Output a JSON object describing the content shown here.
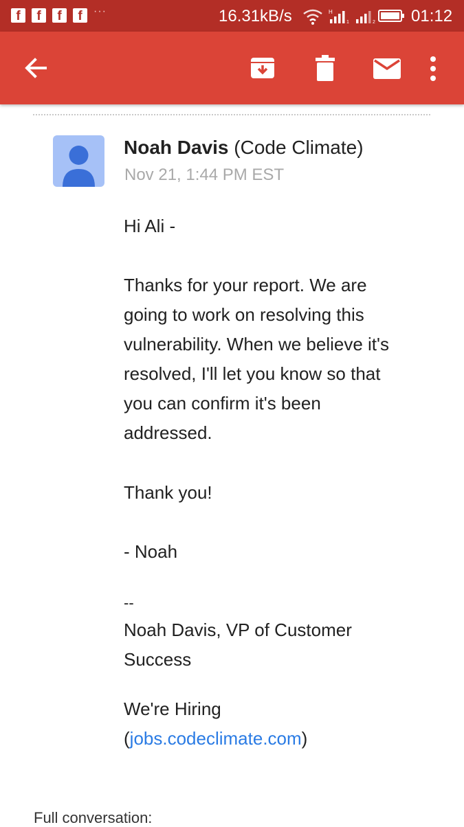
{
  "status_bar": {
    "notification_icons": [
      "facebook-icon",
      "facebook-icon",
      "facebook-icon",
      "facebook-icon"
    ],
    "notification_glyph": "f",
    "overflow": "···",
    "network_speed": "16.31kB/s",
    "time": "01:12"
  },
  "app_bar": {
    "back_icon": "arrow-back-icon",
    "actions": [
      "archive-icon",
      "delete-icon",
      "mark-unread-icon",
      "more-vert-icon"
    ],
    "color": "#db4437"
  },
  "message": {
    "sender_name": "Noah Davis",
    "sender_org": "(Code Climate)",
    "date": "Nov 21, 1:44 PM EST",
    "greeting": "Hi Ali -",
    "body_lines": [
      "Thanks for your report. We are",
      "going to work on resolving this",
      "vulnerability. When we believe it's",
      "resolved, I'll let you know so that",
      "you can confirm it's been",
      "addressed."
    ],
    "thanks": "Thank you!",
    "signoff": "- Noah",
    "sig_separator": "--",
    "signature_lines": [
      "Noah Davis, VP of Customer",
      "Success"
    ],
    "hiring_text": "We're Hiring",
    "open_paren": "(",
    "hiring_link": "jobs.codeclimate.com",
    "close_paren": ")",
    "link_color": "#2a7be4"
  },
  "footer": {
    "full_conversation": "Full conversation:"
  }
}
